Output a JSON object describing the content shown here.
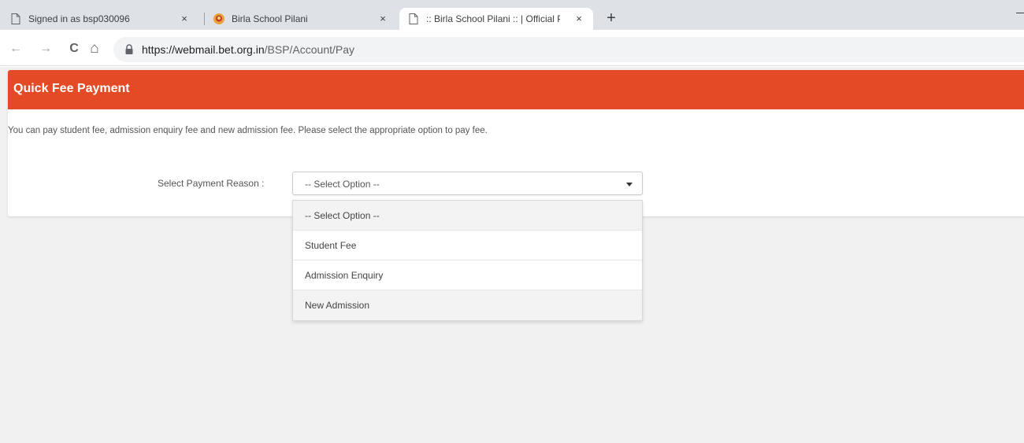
{
  "browser": {
    "tabs": [
      {
        "title": "Signed in as bsp030096",
        "close": "×"
      },
      {
        "title": "Birla School Pilani",
        "close": "×"
      },
      {
        "title": ":: Birla School Pilani :: | Official Po",
        "close": "×"
      }
    ],
    "new_tab": "+",
    "nav": {
      "back": "←",
      "forward": "→",
      "reload": "C",
      "home": "⌂"
    },
    "url": {
      "host": "https://webmail.bet.org.in",
      "path": "/BSP/Account/Pay"
    }
  },
  "page": {
    "header_title": "Quick Fee Payment",
    "description": "You can pay student fee, admission enquiry fee and new admission fee. Please select the appropriate option to pay fee.",
    "payment_reason": {
      "label": "Select Payment Reason :",
      "selected": "-- Select Option --",
      "options": [
        "-- Select Option --",
        "Student Fee",
        "Admission Enquiry",
        "New Admission"
      ]
    }
  },
  "colors": {
    "header": "#e44a26",
    "page_bg": "#f1f1f1",
    "tabstrip": "#dee1e6"
  },
  "icons": [
    "page-icon",
    "birla-logo-icon",
    "close-icon",
    "plus-icon",
    "back-icon",
    "forward-icon",
    "reload-icon",
    "home-icon",
    "lock-icon",
    "caret-down-icon"
  ]
}
